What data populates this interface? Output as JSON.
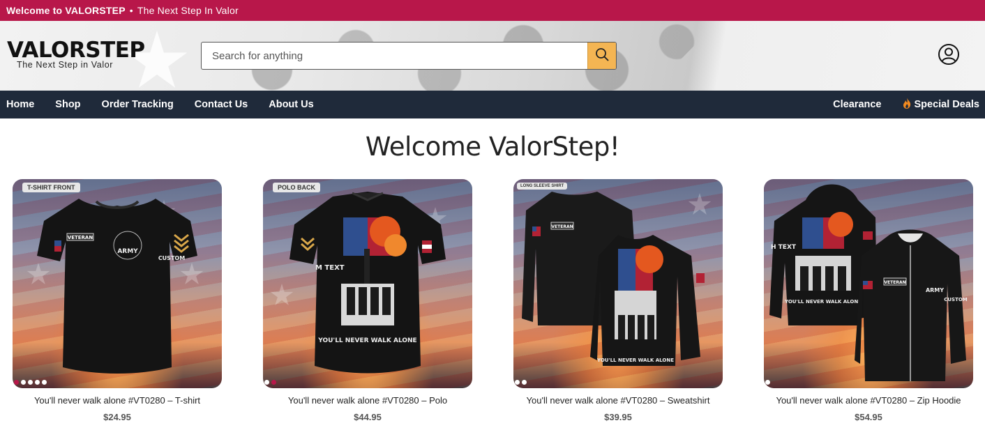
{
  "announcement": {
    "brand_text": "Welcome to VALORSTEP",
    "separator": "•",
    "tagline": "The Next Step In Valor"
  },
  "header": {
    "logo_title": "VALORSTEP",
    "logo_tagline": "The Next Step in Valor",
    "search_placeholder": "Search for anything",
    "search_icon": "search-icon",
    "account_icon": "user-icon"
  },
  "nav": {
    "left": [
      "Home",
      "Shop",
      "Order Tracking",
      "Contact Us",
      "About Us"
    ],
    "clearance": "Clearance",
    "special_deals": "Special Deals",
    "special_deals_icon": "flame-icon"
  },
  "main": {
    "heading": "Welcome ValorStep!"
  },
  "products": [
    {
      "tag": "T-SHIRT FRONT",
      "title": "You'll never walk alone #VT0280 – T-shirt",
      "price": "$24.95",
      "dots": 6,
      "active_dot": 1
    },
    {
      "tag": "POLO BACK",
      "title": "You'll never walk alone #VT0280 – Polo",
      "price": "$44.95",
      "dots": 3,
      "active_dot": 2
    },
    {
      "tag": "LONG SLEEVE SHIRT",
      "title": "You'll never walk alone #VT0280 – Sweatshirt",
      "price": "$39.95",
      "dots": 3,
      "active_dot": 0
    },
    {
      "tag": "",
      "title": "You'll never walk alone #VT0280 – Zip Hoodie",
      "price": "$54.95",
      "dots": 2,
      "active_dot": 0
    }
  ],
  "colors": {
    "announcement_bg": "#b8174a",
    "nav_bg": "#1f2a3a",
    "search_button": "#f4b553",
    "flame": "#f28a1f"
  }
}
